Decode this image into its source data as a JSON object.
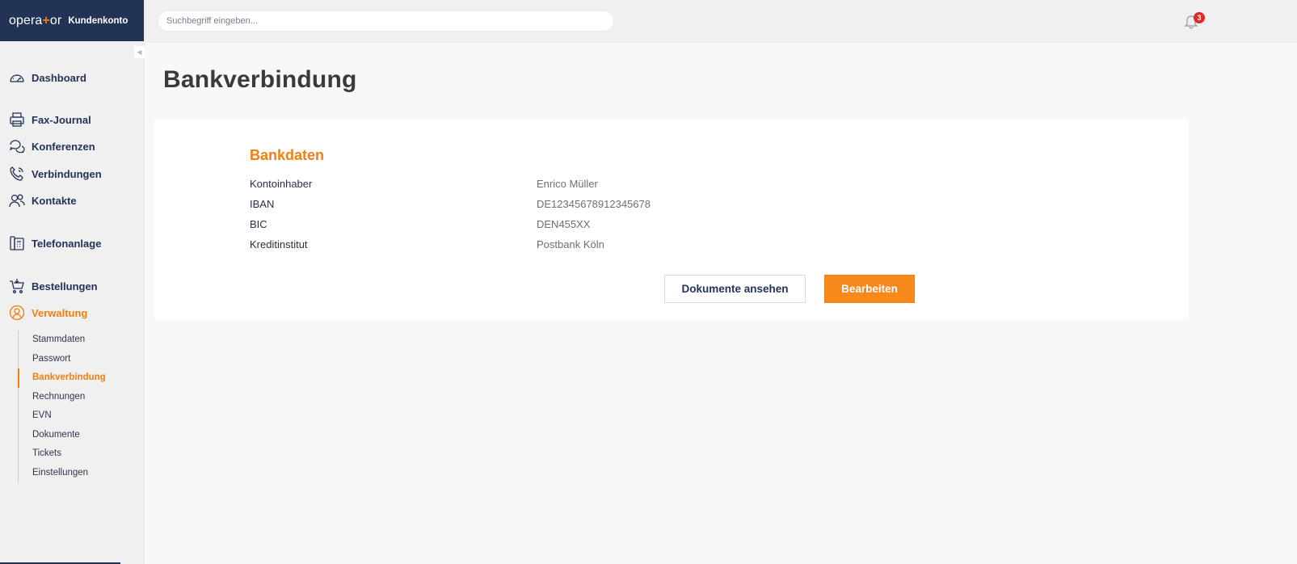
{
  "brand": {
    "logo_text_left": "opera",
    "logo_text_plus": "+",
    "logo_text_right": "or",
    "account_label": "Kundenkonto"
  },
  "sidebar": {
    "collapse_icon": "chevron-left-icon",
    "items": [
      {
        "label": "Dashboard",
        "icon": "speedometer-icon"
      },
      {
        "label": "Fax-Journal",
        "icon": "printer-icon"
      },
      {
        "label": "Konferenzen",
        "icon": "chat-bubbles-icon"
      },
      {
        "label": "Verbindungen",
        "icon": "phone-icon"
      },
      {
        "label": "Kontakte",
        "icon": "contacts-icon"
      },
      {
        "label": "Telefonanlage",
        "icon": "phone-system-icon"
      },
      {
        "label": "Bestellungen",
        "icon": "cart-icon"
      },
      {
        "label": "Verwaltung",
        "icon": "user-circle-icon",
        "active": true
      }
    ],
    "subitems": [
      {
        "label": "Stammdaten"
      },
      {
        "label": "Passwort"
      },
      {
        "label": "Bankverbindung",
        "active": true
      },
      {
        "label": "Rechnungen"
      },
      {
        "label": "EVN"
      },
      {
        "label": "Dokumente"
      },
      {
        "label": "Tickets"
      },
      {
        "label": "Einstellungen"
      }
    ]
  },
  "topbar": {
    "search_placeholder": "Suchbegriff eingeben...",
    "notification_icon": "bell-icon",
    "notification_count": "3"
  },
  "main": {
    "title": "Bankverbindung",
    "card": {
      "title": "Bankdaten",
      "rows": [
        {
          "label": "Kontoinhaber",
          "value": "Enrico Müller"
        },
        {
          "label": "IBAN",
          "value": "DE12345678912345678"
        },
        {
          "label": "BIC",
          "value": "DEN455XX"
        },
        {
          "label": "Kreditinstitut",
          "value": "Postbank Köln"
        }
      ],
      "buttons": {
        "documents": "Dokumente ansehen",
        "edit": "Bearbeiten"
      }
    }
  },
  "colors": {
    "brand_navy": "#233356",
    "accent_orange": "#f07f10",
    "badge_red": "#e32626"
  }
}
